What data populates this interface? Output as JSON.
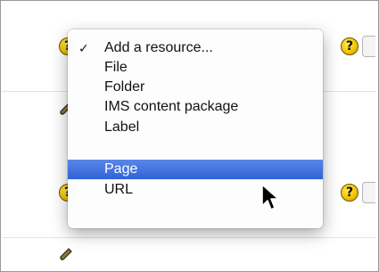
{
  "help_icon": {
    "glyph": "?"
  },
  "menu": {
    "items": [
      {
        "label": "Add a resource...",
        "checked": true,
        "check_glyph": "✓"
      },
      {
        "label": "File"
      },
      {
        "label": "Folder"
      },
      {
        "label": "IMS content package"
      },
      {
        "label": "Label"
      },
      {
        "label": "Page",
        "highlighted": true
      },
      {
        "label": "URL"
      }
    ]
  },
  "colors": {
    "highlight": "#2f63d8",
    "help_icon": "#f1c400"
  },
  "icons": [
    "help-icon",
    "edit-icon",
    "mouse-pointer-icon"
  ]
}
